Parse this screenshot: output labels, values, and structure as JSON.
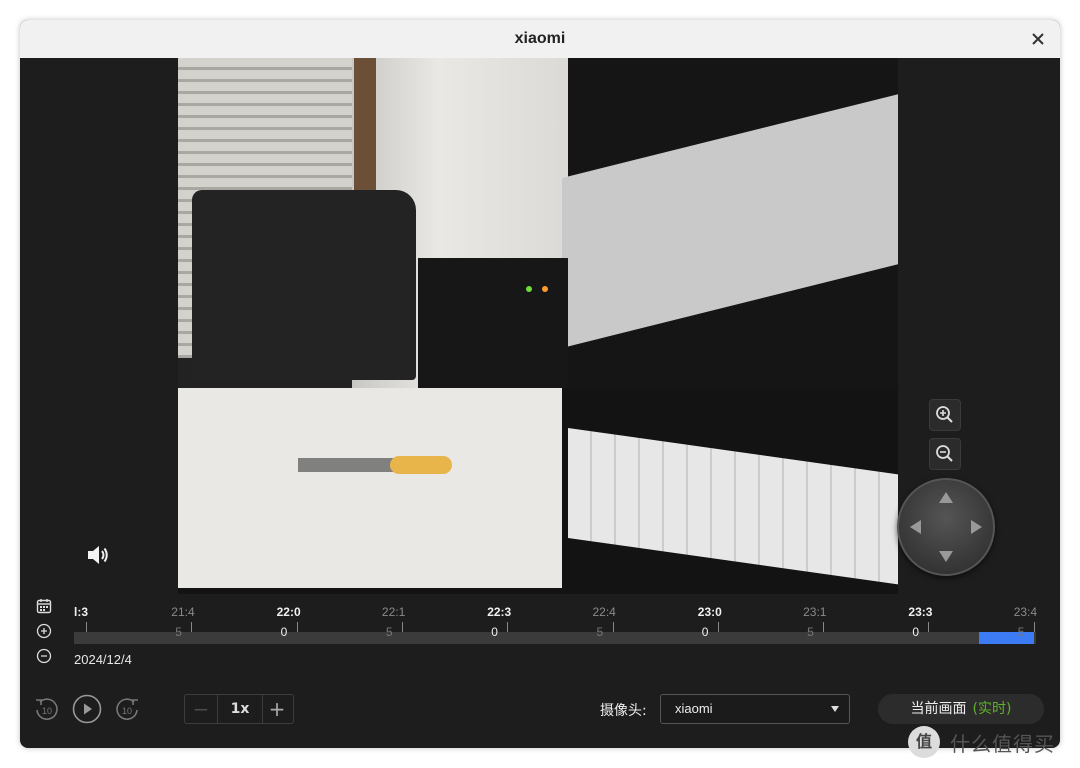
{
  "window": {
    "title": "xiaomi"
  },
  "timeline": {
    "ticks": [
      {
        "label": "l:3",
        "sub": "",
        "major": true
      },
      {
        "label": "21:4",
        "sub": "5",
        "major": false
      },
      {
        "label": "22:0",
        "sub": "0",
        "major": true
      },
      {
        "label": "22:1",
        "sub": "5",
        "major": false
      },
      {
        "label": "22:3",
        "sub": "0",
        "major": true
      },
      {
        "label": "22:4",
        "sub": "5",
        "major": false
      },
      {
        "label": "23:0",
        "sub": "0",
        "major": true
      },
      {
        "label": "23:1",
        "sub": "5",
        "major": false
      },
      {
        "label": "23:3",
        "sub": "0",
        "major": true
      },
      {
        "label": "23:4",
        "sub": "5",
        "major": false
      }
    ],
    "date": "2024/12/4",
    "recorded_color": "#3d7bf5"
  },
  "controls": {
    "back_10_icon": "rewind-10-icon",
    "play_icon": "play-icon",
    "forward_10_icon": "forward-10-icon",
    "speed_minus": "−",
    "speed_value": "1x",
    "speed_plus": "+",
    "camera_label": "摄像头:",
    "camera_value": "xiaomi",
    "live_label": "当前画面",
    "live_status": "(实时)",
    "live_color": "#5fb02c"
  },
  "watermark": {
    "logo_glyph": "值",
    "text": "什么值得买"
  }
}
